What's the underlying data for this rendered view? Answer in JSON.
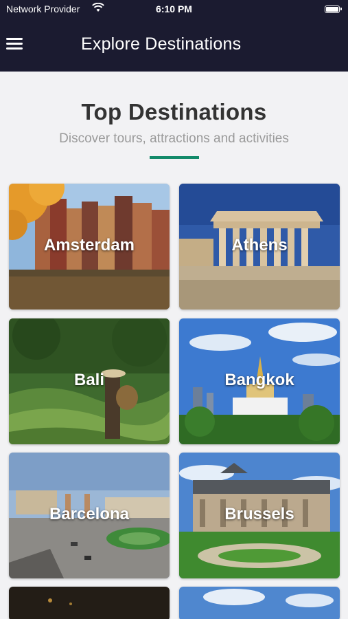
{
  "status_bar": {
    "carrier": "Network Provider",
    "time": "6:10 PM"
  },
  "nav": {
    "title": "Explore Destinations"
  },
  "header": {
    "title": "Top Destinations",
    "subtitle": "Discover tours, attractions and activities",
    "accent_color": "#138a6a"
  },
  "destinations": [
    {
      "name": "Amsterdam"
    },
    {
      "name": "Athens"
    },
    {
      "name": "Bali"
    },
    {
      "name": "Bangkok"
    },
    {
      "name": "Barcelona"
    },
    {
      "name": "Brussels"
    },
    {
      "name": ""
    },
    {
      "name": ""
    }
  ],
  "colors": {
    "nav_background": "#1b1b30",
    "page_background": "#f2f2f4"
  }
}
